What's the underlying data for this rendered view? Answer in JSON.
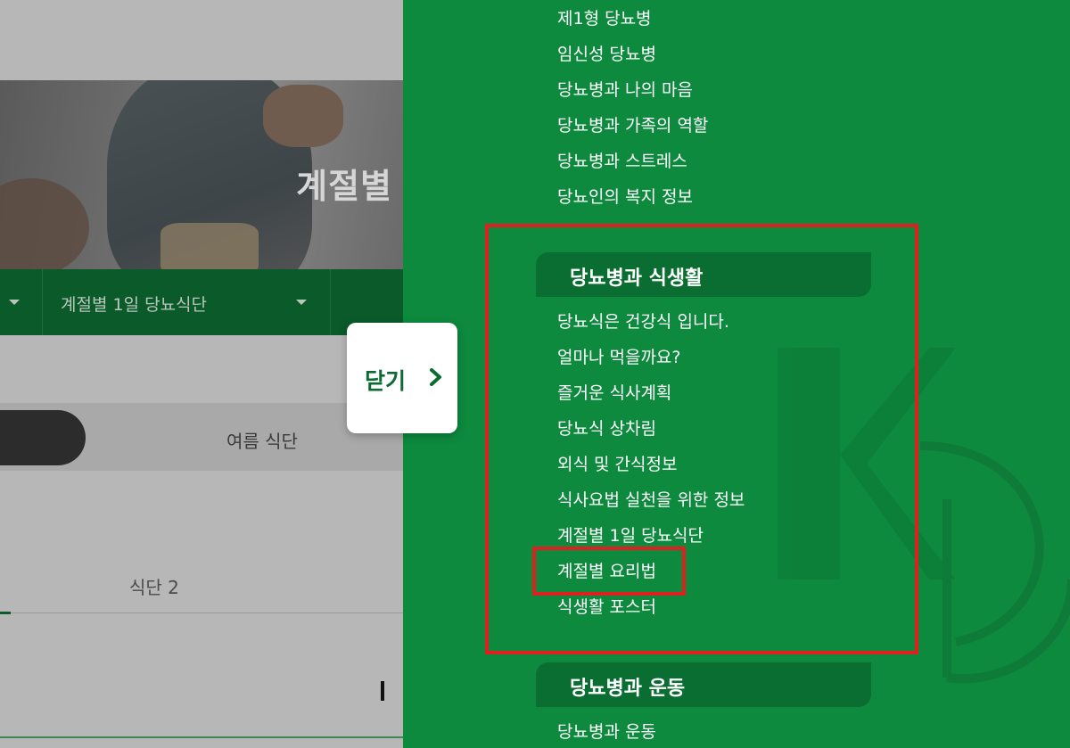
{
  "hero": {
    "title": "계절별"
  },
  "subnav": {
    "selected": "계절별 1일 당뇨식단"
  },
  "season_tabs": {
    "summer": "여름 식단"
  },
  "meal_tabs": {
    "second": "식단 2"
  },
  "close_button": {
    "label": "닫기"
  },
  "menu": {
    "top_links": [
      "제1형 당뇨병",
      "임신성 당뇨병",
      "당뇨병과 나의 마음",
      "당뇨병과 가족의 역할",
      "당뇨병과 스트레스",
      "당뇨인의 복지 정보"
    ],
    "diet_category": {
      "title": "당뇨병과 식생활",
      "links": [
        "당뇨식은 건강식 입니다.",
        "얼마나 먹을까요?",
        "즐거운 식사계획",
        "당뇨식 상차림",
        "외식 및 간식정보",
        "식사요법 실천을 위한 정보",
        "계절별 1일 당뇨식단",
        "계절별 요리법",
        "식생활 포스터"
      ]
    },
    "exercise_category": {
      "title": "당뇨병과 운동",
      "links": [
        "당뇨병과 운동"
      ]
    }
  },
  "colors": {
    "menu_bg": "#0d8a3e",
    "category_bg": "#0a6e32",
    "highlight": "#e02020"
  }
}
